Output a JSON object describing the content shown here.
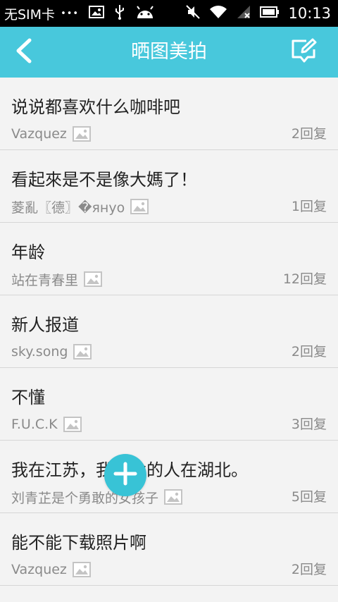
{
  "status_bar": {
    "carrier": "无SIM卡",
    "dots": "•••",
    "time": "10:13"
  },
  "app_bar": {
    "title": "晒图美拍"
  },
  "posts": [
    {
      "title": "说说都喜欢什么咖啡吧",
      "author": "Vazquez",
      "replies": "2回复"
    },
    {
      "title": "看起來是不是像大媽了！",
      "author": "菱亂〖德〗�януо",
      "replies": "1回复"
    },
    {
      "title": "年龄",
      "author": "站在青春里",
      "replies": "12回复"
    },
    {
      "title": "新人报道",
      "author": "sky.song",
      "replies": "2回复"
    },
    {
      "title": "不懂",
      "author": "F.U.C.K",
      "replies": "3回复"
    },
    {
      "title": "我在江苏，我想念的人在湖北。",
      "author": "刘青芷是个勇敢的女孩子",
      "replies": "5回复"
    },
    {
      "title": "能不能下载照片啊",
      "author": "Vazquez",
      "replies": "2回复"
    }
  ],
  "colors": {
    "accent": "#48c8dc",
    "fab": "#38c3d6"
  },
  "icons": {
    "back": "chevron-left-icon",
    "compose": "compose-icon",
    "image": "image-icon",
    "fab": "plus-icon"
  }
}
